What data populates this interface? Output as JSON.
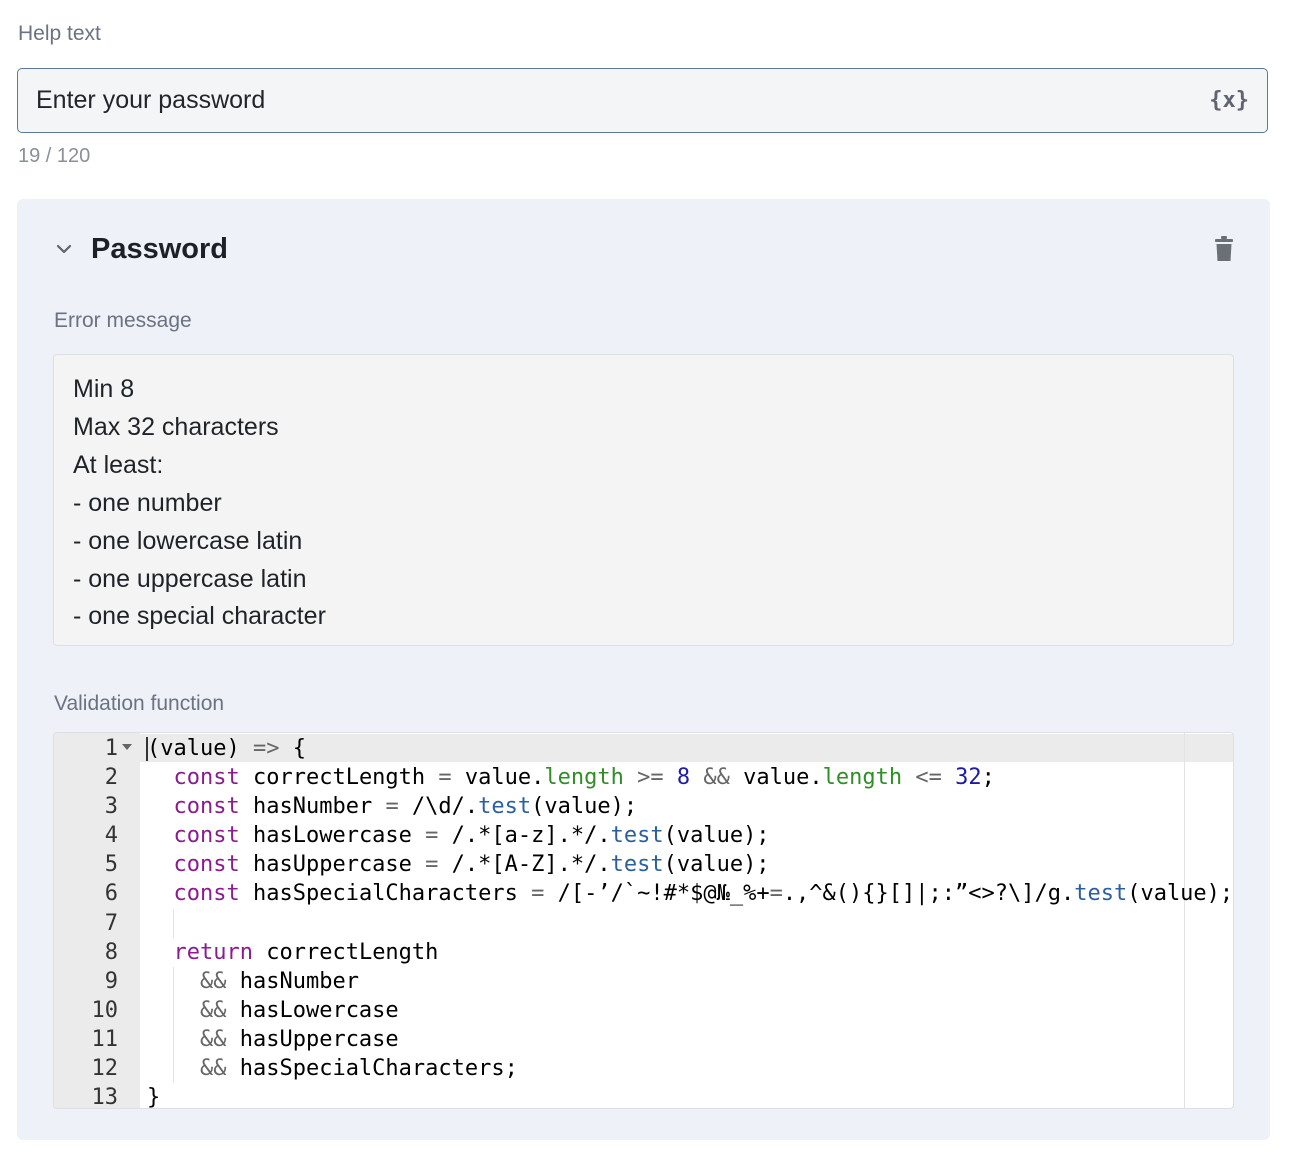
{
  "help_text": {
    "label": "Help text",
    "value": "Enter your password",
    "variable_icon": "curly-braces-x-icon",
    "counter": "19 / 120"
  },
  "panel": {
    "title": "Password",
    "collapse_icon": "chevron-down-icon",
    "delete_icon": "trash-icon",
    "error_message": {
      "label": "Error message",
      "lines": [
        "Min 8",
        "Max 32 characters",
        "At least:",
        "- one number",
        "- one lowercase latin",
        "- one uppercase latin",
        "- one special character"
      ]
    },
    "validation_function": {
      "label": "Validation function",
      "line_numbers": [
        "1",
        "2",
        "3",
        "4",
        "5",
        "6",
        "7",
        "8",
        "9",
        "10",
        "11",
        "12",
        "13"
      ],
      "code_lines": [
        "(value) => {",
        "  const correctLength = value.length >= 8 && value.length <= 32;",
        "  const hasNumber = /\\d/.test(value);",
        "  const hasLowercase = /.*[a-z].*/.test(value);",
        "  const hasUppercase = /.*[A-Z].*/.test(value);",
        "  const hasSpecialCharacters = /[-’/`~!#*$@№_%+=.,^&(){}[]|;:”<>?\\]/g.test(value);",
        "",
        "  return correctLength",
        "    && hasNumber",
        "    && hasLowercase",
        "    && hasUppercase",
        "    && hasSpecialCharacters;",
        "}"
      ]
    }
  },
  "colors": {
    "keyword": "#8a1c8f",
    "number": "#1b1ba6",
    "property": "#2f8f26",
    "regex": "#2a3fd6",
    "panel_bg": "#eef2f8"
  }
}
